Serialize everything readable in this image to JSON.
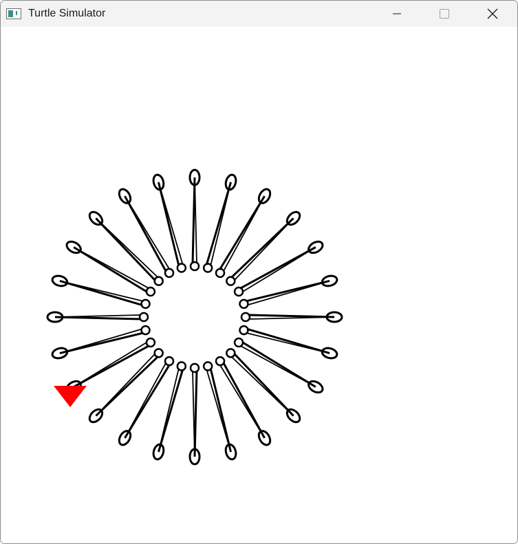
{
  "window": {
    "title": "Turtle Simulator",
    "app_icon": "turtle-window-icon",
    "controls": [
      {
        "name": "minimize",
        "icon": "minimize-icon"
      },
      {
        "name": "maximize",
        "icon": "maximize-icon"
      },
      {
        "name": "close",
        "icon": "close-icon"
      }
    ]
  },
  "drawing": {
    "pattern": "looped star of 24 teardrop loops",
    "loop_count": 24,
    "line_color": "#000000",
    "turtle_color": "#ff0000",
    "turtle_icon": "turtle-cursor-icon"
  }
}
